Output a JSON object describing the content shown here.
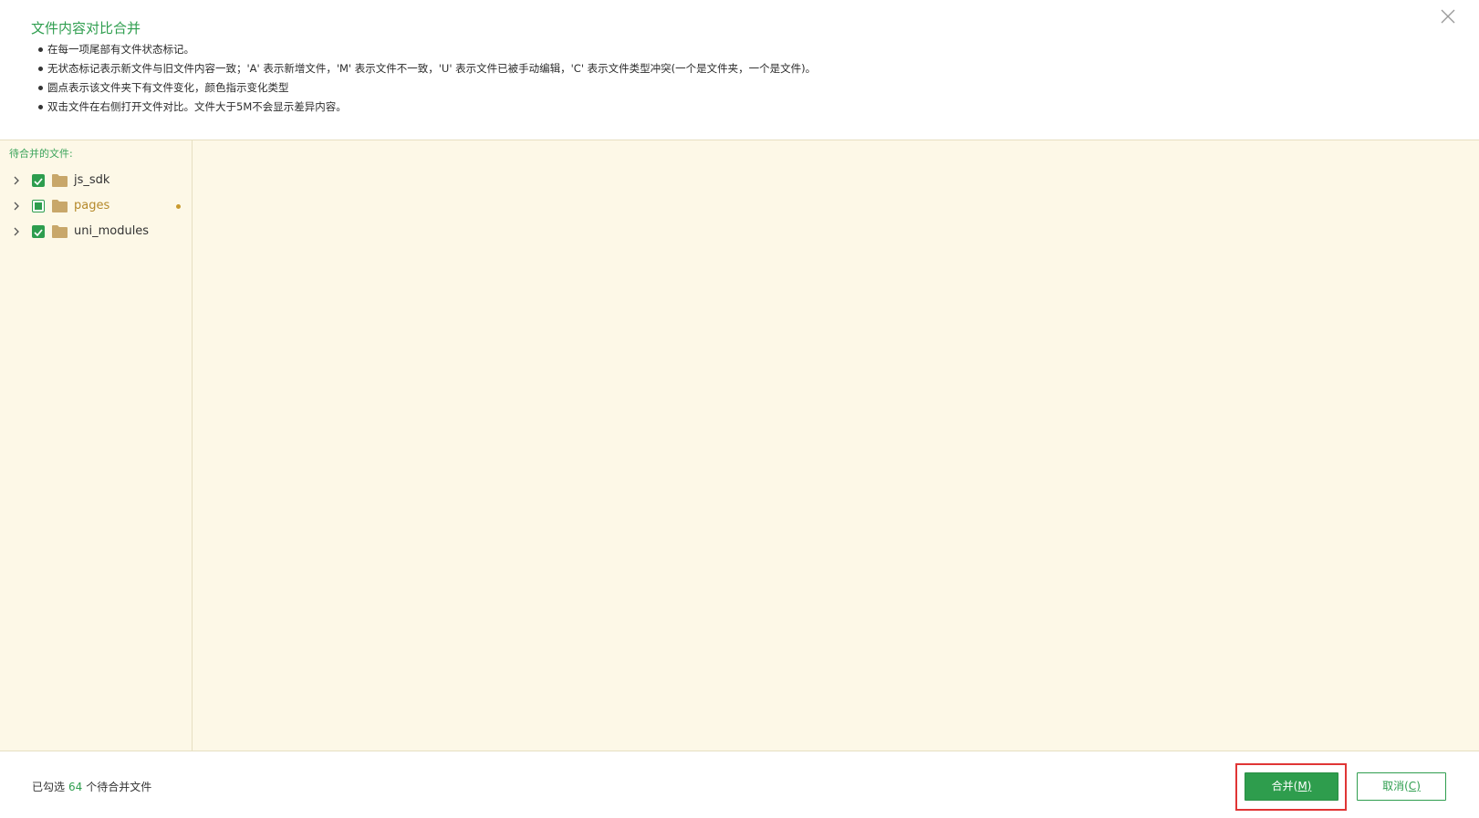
{
  "dialog": {
    "title": "文件内容对比合并",
    "notes": [
      "在每一项尾部有文件状态标记。",
      "无状态标记表示新文件与旧文件内容一致；'A' 表示新增文件，'M' 表示文件不一致，'U' 表示文件已被手动编辑，'C' 表示文件类型冲突(一个是文件夹，一个是文件)。",
      "圆点表示该文件夹下有文件变化，颜色指示变化类型",
      "双击文件在右侧打开文件对比。文件大于5M不会显示差异内容。"
    ]
  },
  "left_panel": {
    "label": "待合并的文件:",
    "tree": [
      {
        "name": "js_sdk",
        "checked": "checked",
        "changed": false
      },
      {
        "name": "pages",
        "checked": "partial",
        "changed": true
      },
      {
        "name": "uni_modules",
        "checked": "checked",
        "changed": false
      }
    ]
  },
  "footer": {
    "status_prefix": "已勾选",
    "status_count": "64",
    "status_suffix": "个待合并文件",
    "merge_label": "合并(",
    "merge_key": "M",
    "merge_close": ")",
    "cancel_label": "取消(",
    "cancel_key": "C",
    "cancel_close": ")"
  },
  "colors": {
    "accent": "#2f9e4f",
    "panel_bg": "#fdf8e7",
    "changed_dot": "#c99a2e",
    "highlight": "#e03535"
  },
  "icons": {
    "close": "close-icon",
    "expand": "chevron-right-icon",
    "folder": "folder-icon",
    "check": "check-icon"
  }
}
